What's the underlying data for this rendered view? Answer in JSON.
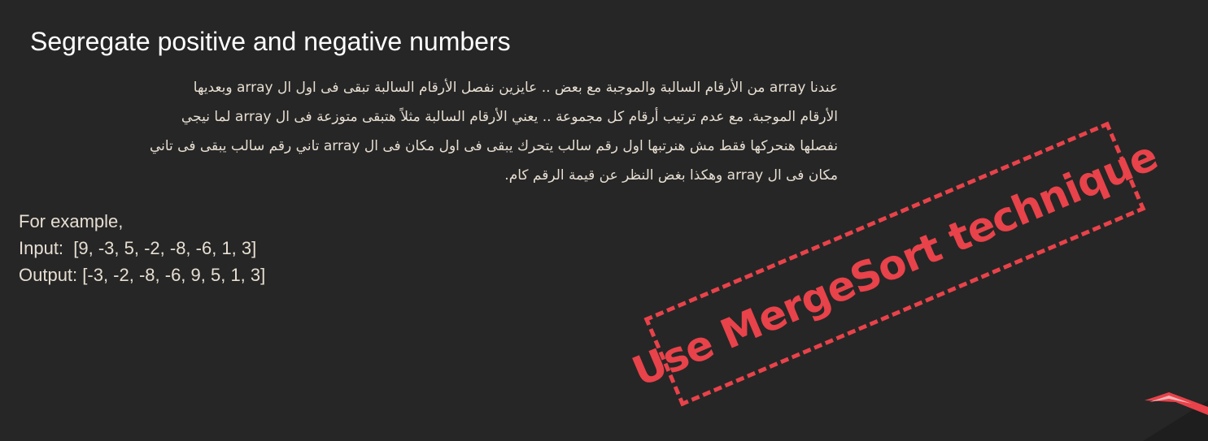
{
  "slide": {
    "title": "Segregate positive and negative numbers",
    "description_lines": [
      "عندنا array من الأرقام السالبة والموجبة مع بعض .. عايزين نفصل الأرقام السالبة تبقى فى اول ال array وبعديها",
      "الأرقام الموجبة. مع عدم ترتيب أرقام كل مجموعة .. يعني الأرقام السالبة مثلاً هتبقى متوزعة فى ال array لما نيجي",
      "نفصلها هنحركها فقط مش هنرتبها اول رقم سالب يتحرك يبقى فى اول مكان فى ال array تاني رقم سالب يبقى فى تاني",
      "مكان فى ال array وهكذا بغض النظر عن قيمة الرقم كام."
    ],
    "example": {
      "heading": "For example,",
      "input": "Input:  [9, -3, 5, -2, -8, -6, 1, 3]",
      "output": "Output: [-3, -2, -8, -6, 9, 5, 1, 3]"
    },
    "stamp": {
      "text": "Use MergeSort technique",
      "color": "#e8424a"
    }
  }
}
